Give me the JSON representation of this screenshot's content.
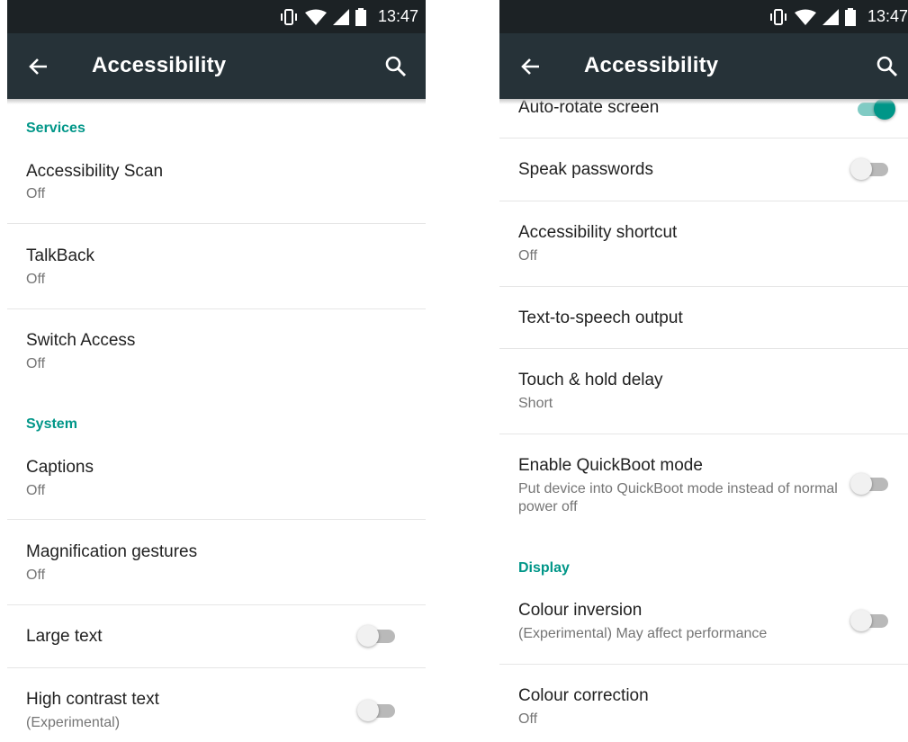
{
  "colors": {
    "accent": "#009688",
    "toolbar": "#263238",
    "statusbar": "#1c2225"
  },
  "icons": {
    "status": [
      "vibrate-icon",
      "wifi-icon",
      "cell-signal-icon",
      "battery-icon"
    ],
    "toolbar": [
      "back-arrow-icon",
      "search-icon"
    ]
  },
  "left": {
    "status_time": "13:47",
    "title": "Accessibility",
    "sections": [
      {
        "header": "Services",
        "items": [
          {
            "title": "Accessibility Scan",
            "summary": "Off"
          },
          {
            "title": "TalkBack",
            "summary": "Off"
          },
          {
            "title": "Switch Access",
            "summary": "Off"
          }
        ]
      },
      {
        "header": "System",
        "items": [
          {
            "title": "Captions",
            "summary": "Off"
          },
          {
            "title": "Magnification gestures",
            "summary": "Off"
          },
          {
            "title": "Large text",
            "switch_on": false
          },
          {
            "title": "High contrast text",
            "summary": "(Experimental)",
            "switch_on": false
          }
        ]
      }
    ]
  },
  "right": {
    "status_time": "13:47",
    "title": "Accessibility",
    "items": [
      {
        "title": "Auto-rotate screen",
        "switch_on": true
      },
      {
        "title": "Speak passwords",
        "switch_on": false
      },
      {
        "title": "Accessibility shortcut",
        "summary": "Off"
      },
      {
        "title": "Text-to-speech output"
      },
      {
        "title": "Touch & hold delay",
        "summary": "Short"
      },
      {
        "title": "Enable QuickBoot mode",
        "summary": "Put device into QuickBoot mode instead of normal power off",
        "switch_on": false
      }
    ],
    "display_header": "Display",
    "display_items": [
      {
        "title": "Colour inversion",
        "summary": "(Experimental) May affect performance",
        "switch_on": false
      },
      {
        "title": "Colour correction",
        "summary": "Off"
      }
    ]
  }
}
